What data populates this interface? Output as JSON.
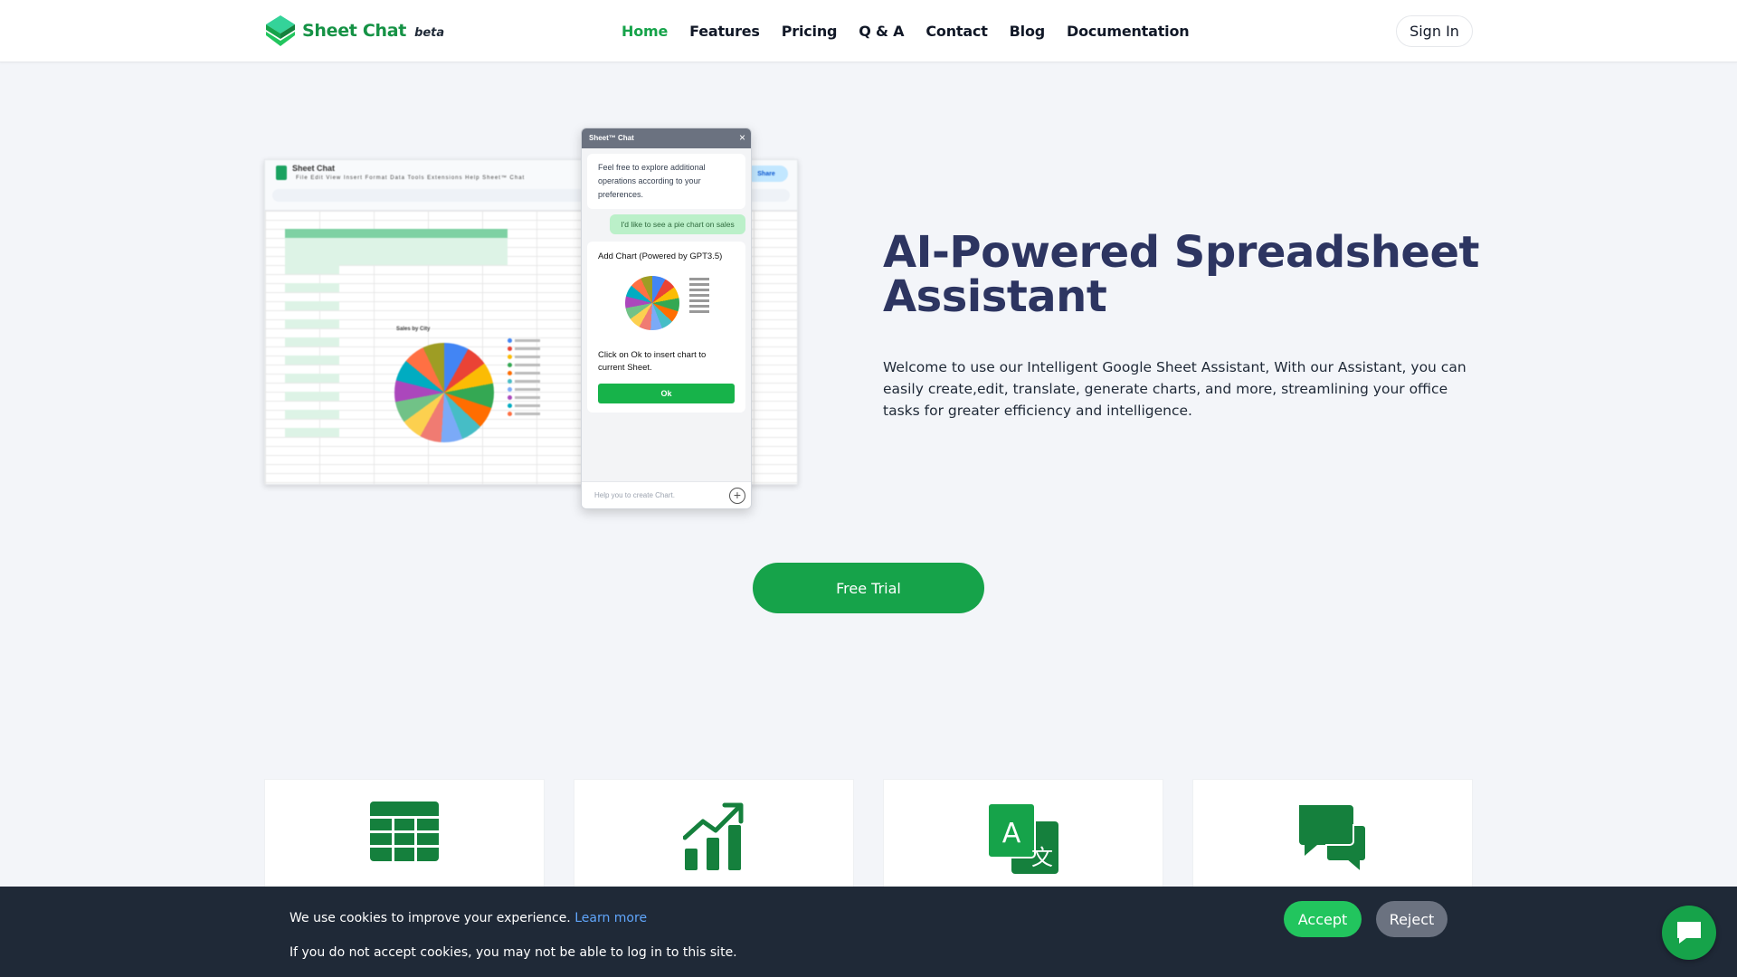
{
  "brand": {
    "name": "Sheet Chat",
    "badge": "beta",
    "accent": "#16a34a",
    "title_color": "#2d3561"
  },
  "nav": {
    "items": [
      {
        "label": "Home",
        "active": true
      },
      {
        "label": "Features"
      },
      {
        "label": "Pricing"
      },
      {
        "label": "Q & A"
      },
      {
        "label": "Contact"
      },
      {
        "label": "Blog"
      },
      {
        "label": "Documentation"
      }
    ],
    "signin_label": "Sign In"
  },
  "hero": {
    "title": "AI-Powered Spreadsheet Assistant",
    "description": "Welcome to use our Intelligent Google Sheet Assistant, With our Assistant, you can easily create,edit, translate, generate charts, and more, streamlining your office tasks for greater efficiency and intelligence.",
    "cta_label": "Free Trial"
  },
  "preview": {
    "sheet_title": "Sheet Chat",
    "sheet_menu": "File  Edit  View  Insert  Format  Data  Tools  Extensions  Help  Sheet™ Chat",
    "share_label": "Share",
    "chart_title": "Sales by City",
    "chat_title": "Sheet™ Chat",
    "assistant_message": "Feel free to explore additional operations according to your preferences.",
    "user_message": "I'd like to see a pie chart on sales",
    "card_title": "Add Chart (Powered by GPT3.5)",
    "card_note": "Click on Ok to insert chart to current Sheet.",
    "ok_label": "Ok",
    "input_placeholder": "Help you to create Chart."
  },
  "features": [
    {
      "icon": "table-icon"
    },
    {
      "icon": "chart-growth-icon"
    },
    {
      "icon": "translate-icon"
    },
    {
      "icon": "chat-bubbles-icon"
    }
  ],
  "cookie": {
    "message": "We use cookies to improve your experience.",
    "learn_more": "Learn more",
    "warning": "If you do not accept cookies, you may not be able to log in to this site.",
    "accept_label": "Accept",
    "reject_label": "Reject"
  }
}
